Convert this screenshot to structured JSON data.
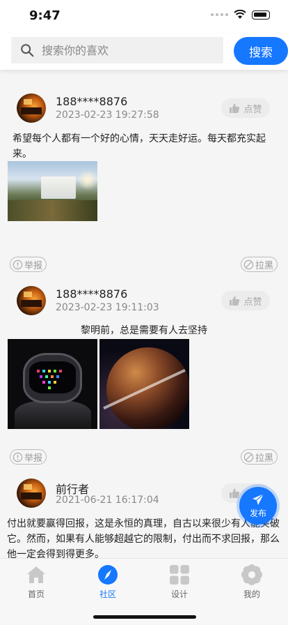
{
  "status_bar": {
    "time": "9:47"
  },
  "search": {
    "placeholder": "搜索你的喜欢",
    "button_label": "搜索"
  },
  "posts": [
    {
      "username": "188****8876",
      "timestamp": "2023-02-23 19:27:58",
      "like_label": "点赞",
      "content": "希望每个人都有一个好的心情，天天走好运。每天都充实起来。",
      "report_label": "举报",
      "block_label": "拉黑"
    },
    {
      "username": "188****8876",
      "timestamp": "2023-02-23 19:11:03",
      "like_label": "点赞",
      "content": "黎明前，总是需要有人去坚持",
      "report_label": "举报",
      "block_label": "拉黑"
    },
    {
      "username": "前行者",
      "timestamp": "2021-06-21 16:17:04",
      "like_label": "点赞",
      "content": "付出就要赢得回报，这是永恒的真理，自古以来很少有人能突破它。然而，如果有人能够超越它的限制，付出而不求回报，那么他一定会得到得更多。"
    }
  ],
  "fab": {
    "label": "发布"
  },
  "tabs": [
    {
      "label": "首页",
      "icon": "home-icon"
    },
    {
      "label": "社区",
      "icon": "compass-icon",
      "active": true
    },
    {
      "label": "设计",
      "icon": "grid-icon"
    },
    {
      "label": "我的",
      "icon": "flower-icon"
    }
  ],
  "colors": {
    "accent": "#1677ff",
    "inactive_icon": "#c8c8c8"
  }
}
